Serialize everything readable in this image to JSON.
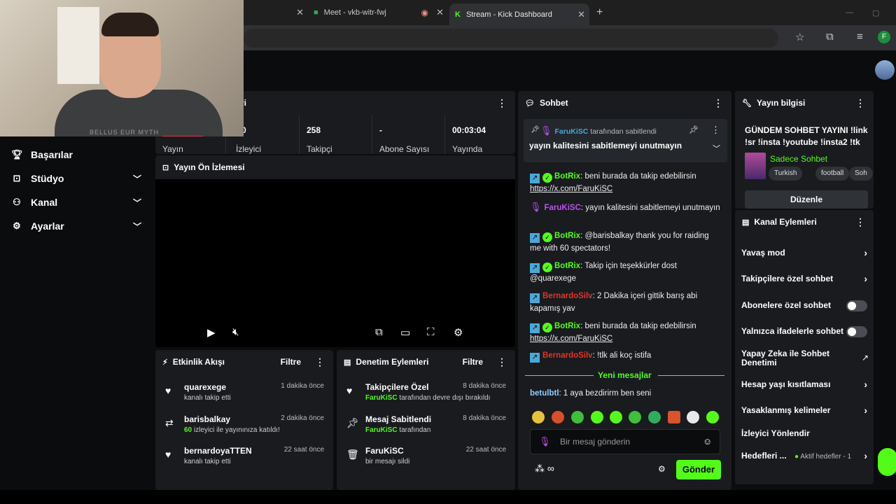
{
  "browser": {
    "tabs": [
      {
        "title": ""
      },
      {
        "title": "Meet - vkb-witr-fwj"
      },
      {
        "title": "Stream - Kick Dashboard"
      }
    ],
    "new_tab": "+",
    "profile_initial": "F"
  },
  "webcam": {
    "shirt_text": "BELLUS EUR MYTH"
  },
  "sidebar": {
    "items": [
      {
        "label": "Başarılar",
        "icon": "trophy-icon"
      },
      {
        "label": "Stüdyo",
        "icon": "studio-icon"
      },
      {
        "label": "Kanal",
        "icon": "channel-icon"
      },
      {
        "label": "Ayarlar",
        "icon": "gear-icon"
      }
    ]
  },
  "stats": {
    "title_partial": "ri",
    "items": [
      {
        "value": "",
        "label": "Yayın"
      },
      {
        "value": "0",
        "label": "İzleyici"
      },
      {
        "value": "258",
        "label": "Takipçi"
      },
      {
        "value": "-",
        "label": "Abone Sayısı"
      },
      {
        "value": "00:03:04",
        "label": "Yayında"
      }
    ]
  },
  "preview": {
    "title": "Yayın Ön İzlemesi"
  },
  "activity": {
    "title": "Etkinlik Akışı",
    "filter": "Filtre",
    "items": [
      {
        "title": "quarexege",
        "sub": "kanalı takip etti",
        "time": "1 dakika önce",
        "icon": "heart-icon"
      },
      {
        "title": "barisbalkay",
        "highlight": "60",
        "sub": " izleyici ile yayınınıza katıldı!",
        "time": "2 dakika önce",
        "icon": "raid-icon"
      },
      {
        "title": "bernardoyaTTEN",
        "sub": "kanalı takip etti",
        "time": "22 saat önce",
        "icon": "heart-icon"
      }
    ]
  },
  "moderation": {
    "title": "Denetim Eylemleri",
    "filter": "Filtre",
    "items": [
      {
        "title": "Takipçilere Özel",
        "highlight": "FaruKiSC",
        "sub": " tarafından devre dışı bırakıldı",
        "time": "8 dakika önce",
        "icon": "heart-icon"
      },
      {
        "title": "Mesaj Sabitlendi",
        "highlight": "FaruKiSC",
        "sub": " tarafından",
        "time": "8 dakika önce",
        "icon": "pin-icon"
      },
      {
        "title": "FaruKiSC",
        "sub": "bir mesajı sildi",
        "time": "22 saat önce",
        "icon": "trash-icon"
      }
    ]
  },
  "chat": {
    "title": "Sohbet",
    "pinned": {
      "user": "FaruKiSC",
      "by": " tarafından sabitlendi",
      "text": "yayın kalitesini sabitlemeyi unutmayın"
    },
    "messages": [
      {
        "user": "BotRix",
        "color": "#53fc18",
        "badges": "kv",
        "text": ": beni burada da takip edebilirsin ",
        "link": "https://x.com/FaruKiSC"
      },
      {
        "user": "FaruKiSC",
        "color": "#c050f0",
        "badges": "m",
        "text": ": yayın kalitesini sabitlemeyi unutmayın"
      },
      {
        "user": "BotRix",
        "color": "#53fc18",
        "badges": "kv",
        "text": ": @barisbalkay thank you for raiding me with 60 spectators!"
      },
      {
        "user": "BotRix",
        "color": "#53fc18",
        "badges": "kv",
        "text": ": Takip için teşekkürler dost @quarexege"
      },
      {
        "user": "BernardoSilv",
        "color": "#e0352b",
        "badges": "k",
        "text": ": 2 Dakika içeri gittik barış abi kapamış yav"
      },
      {
        "user": "BotRix",
        "color": "#53fc18",
        "badges": "kv",
        "text": ": beni burada da takip edebilirsin ",
        "link": "https://x.com/FaruKiSC"
      },
      {
        "user": "BernardoSilv",
        "color": "#e0352b",
        "badges": "k",
        "text": ": !tlk ali koç istifa"
      }
    ],
    "new_messages": "Yeni mesajlar",
    "latest": {
      "user": "betulbtl",
      "text": ": 1 aya bezdirirm ben seni"
    },
    "input_placeholder": "Bir mesaj gönderin",
    "send": "Gönder"
  },
  "info": {
    "title": "Yayın bilgisi",
    "stream_title": "GÜNDEM SOHBET YAYINI !link !sr !insta !youtube !insta2 !tk",
    "category": "Sadece Sohbet",
    "tags": [
      "Turkish",
      "football",
      "Soh"
    ],
    "edit": "Düzenle"
  },
  "actions": {
    "title": "Kanal Eylemleri",
    "items": [
      {
        "label": "Yavaş mod",
        "type": "arrow"
      },
      {
        "label": "Takipçilere özel sohbet",
        "type": "arrow"
      },
      {
        "label": "Abonelere özel sohbet",
        "type": "toggle"
      },
      {
        "label": "Yalnızca ifadelerle sohbet",
        "type": "toggle"
      },
      {
        "label": "Yapay Zeka ile Sohbet Denetimi",
        "type": "external"
      },
      {
        "label": "Hesap yaşı kısıtlaması",
        "type": "arrow"
      },
      {
        "label": "Yasaklanmış kelimeler",
        "type": "arrow"
      },
      {
        "label": "İzleyici Yönlendir",
        "type": "none"
      },
      {
        "label": "Hedefleri ...",
        "type": "arrow",
        "extra": "Aktif hedefler - 1"
      }
    ]
  }
}
